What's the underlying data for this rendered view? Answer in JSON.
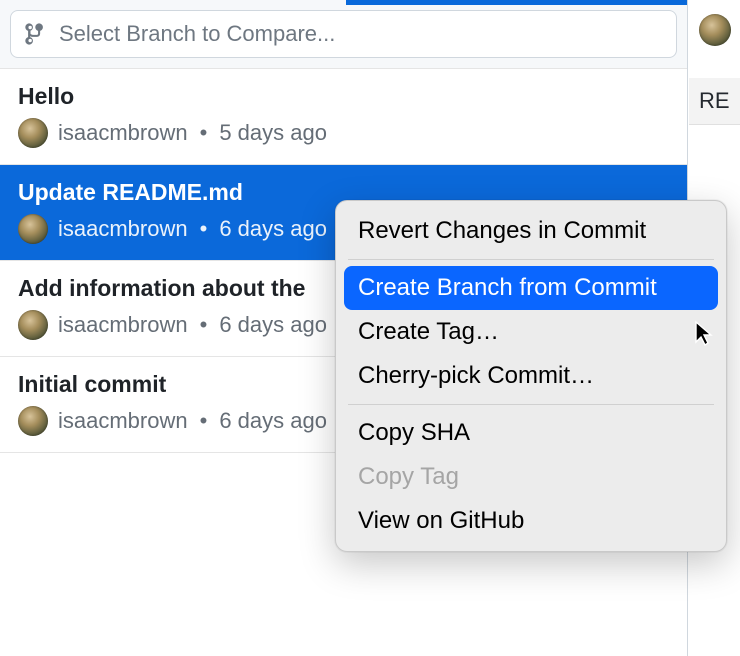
{
  "branch_selector": {
    "placeholder": "Select Branch to Compare..."
  },
  "commits": [
    {
      "title": "Hello",
      "author": "isaacmbrown",
      "time": "5 days ago",
      "selected": false
    },
    {
      "title": "Update README.md",
      "author": "isaacmbrown",
      "time": "6 days ago",
      "selected": true
    },
    {
      "title": "Add information about the",
      "author": "isaacmbrown",
      "time": "6 days ago",
      "selected": false
    },
    {
      "title": "Initial commit",
      "author": "isaacmbrown",
      "time": "6 days ago",
      "selected": false
    }
  ],
  "right_panel": {
    "label": "RE"
  },
  "context_menu": {
    "items": [
      {
        "label": "Revert Changes in Commit",
        "highlighted": false,
        "disabled": false
      },
      {
        "separator": true
      },
      {
        "label": "Create Branch from Commit",
        "highlighted": true,
        "disabled": false
      },
      {
        "label": "Create Tag…",
        "highlighted": false,
        "disabled": false
      },
      {
        "label": "Cherry-pick Commit…",
        "highlighted": false,
        "disabled": false
      },
      {
        "separator": true
      },
      {
        "label": "Copy SHA",
        "highlighted": false,
        "disabled": false
      },
      {
        "label": "Copy Tag",
        "highlighted": false,
        "disabled": true
      },
      {
        "label": "View on GitHub",
        "highlighted": false,
        "disabled": false
      }
    ]
  }
}
